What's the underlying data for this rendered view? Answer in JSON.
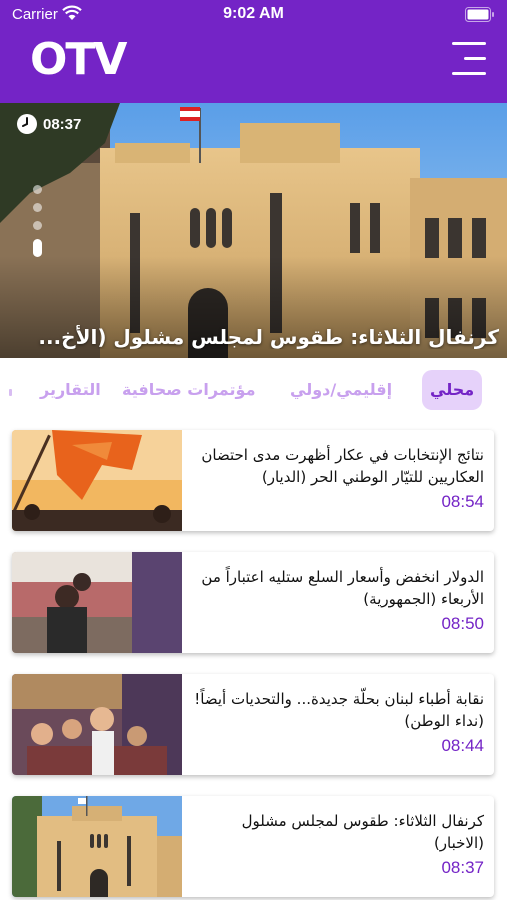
{
  "status_bar": {
    "carrier": "Carrier",
    "time": "9:02 AM"
  },
  "header": {
    "logo_text": "OTV",
    "menu_icon": "hamburger-icon",
    "background": "#7424c6"
  },
  "hero": {
    "time": "08:37",
    "title": "كرنفال الثلاثاء: طقوس لمجلس مشلول (الأخ...",
    "slide_count": 4,
    "active_slide": 4
  },
  "tabs": [
    {
      "label": "محلي",
      "active": true
    },
    {
      "label": "إقليمي/دولي",
      "active": false
    },
    {
      "label": "مؤتمرات صحافية",
      "active": false
    },
    {
      "label": "التقارير",
      "active": false
    }
  ],
  "news": [
    {
      "headline": "نتائج الإنتخابات في عكار أظهرت مدى احتضان العكاريين للتيّار الوطني الحر (الديار)",
      "time": "08:54",
      "thumb": "flag-rally"
    },
    {
      "headline": "الدولار انخفض وأسعار السلع ستليه اعتباراً من الأربعاء (الجمهورية)",
      "time": "08:50",
      "thumb": "supermarket"
    },
    {
      "headline": "نقابة أطباء لبنان بحلّة جديدة... والتحديات أيضاً! (نداء الوطن)",
      "time": "08:44",
      "thumb": "crowd"
    },
    {
      "headline": "كرنفال الثلاثاء: طقوس لمجلس مشلول (الاخبار)",
      "time": "08:37",
      "thumb": "parliament"
    }
  ],
  "colors": {
    "brand": "#7424c6",
    "tab_active_bg": "#e6d2fa",
    "tab_inactive": "#c8a0ee"
  }
}
